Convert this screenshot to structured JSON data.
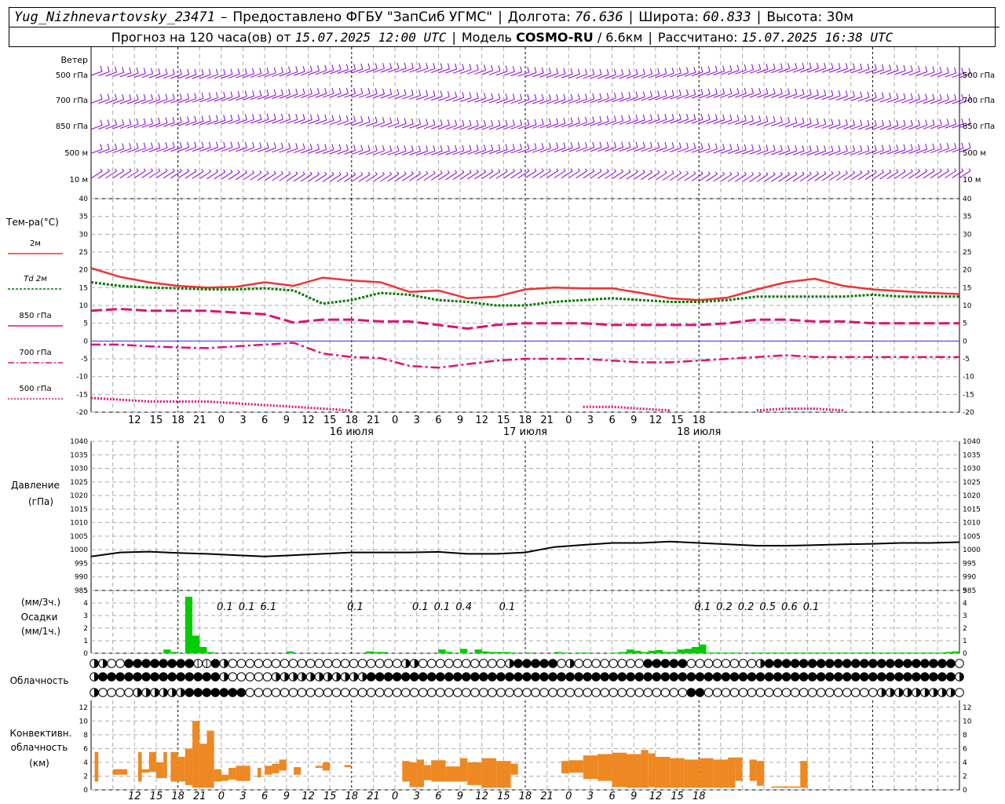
{
  "header": {
    "station": "Yug_Nizhnevartovsky_23471",
    "dash": "–",
    "provider": "Предоставлено ФГБУ \"ЗапСиб УГМС\"",
    "lon_label": "Долгота:",
    "lon_value": "76.636",
    "lat_label": "Широта:",
    "lat_value": "60.833",
    "alt_label": "Высота:",
    "alt_value": "30м",
    "forecast_label": "Прогноз на 120 часа(ов) от",
    "forecast_time": "15.07.2025 12:00 UTC",
    "model_label": "Модель",
    "model_name": "COSMO-RU",
    "model_res": "/ 6.6км",
    "computed_label": "Рассчитано:",
    "computed_time": "15.07.2025 16:38 UTC"
  },
  "panels": {
    "wind": {
      "title": "Ветер",
      "levels": [
        "500 гПа",
        "700 гПа",
        "850 гПа",
        "500 м",
        "10 м"
      ]
    },
    "temp": {
      "title": "Тем-ра(°C)",
      "legend": [
        "2м",
        "Td 2м",
        "850 гПа",
        "700 гПа",
        "500 гПа"
      ]
    },
    "pressure": {
      "title1": "Давление",
      "title2": "(гПа)"
    },
    "precip": {
      "title1": "(мм/3ч.)",
      "title2": "Осадки",
      "title3": "(мм/1ч.)"
    },
    "clouds": {
      "title": "Облачность"
    },
    "conv": {
      "title1": "Конвективн.",
      "title2": "облачность",
      "title3": "(км)"
    }
  },
  "colors": {
    "t2m": "#ee3333",
    "td2m": "#007700",
    "t850": "#dd1177",
    "t700": "#dd1177",
    "t500": "#dd1177",
    "wind": "#8800cc",
    "precip": "#00cc00",
    "conv": "#ee8822",
    "pressure": "#000000",
    "grid": "#aaaaaa",
    "zero": "#3333ff"
  },
  "chart_data": [
    {
      "type": "line",
      "title": "Тем-ра(°C)",
      "x_hours": [
        0,
        3,
        6,
        9,
        12,
        15,
        18,
        21,
        24,
        27,
        30,
        33,
        36,
        39,
        42,
        45,
        48,
        51,
        54,
        57,
        60,
        63,
        66,
        69,
        72,
        75,
        78,
        81,
        84,
        87,
        90,
        93,
        96,
        99,
        102,
        105,
        108,
        111,
        114,
        117,
        120
      ],
      "x_tick_labels": [
        "12",
        "15",
        "18",
        "21",
        "0",
        "3",
        "6",
        "9",
        "12",
        "15",
        "18",
        "21",
        "0",
        "3",
        "6",
        "9",
        "12",
        "15",
        "18",
        "21",
        "0",
        "3",
        "6",
        "9",
        "12",
        "15",
        "18"
      ],
      "date_labels": [
        "16 июля",
        "17 июля",
        "18 июля"
      ],
      "ylim": [
        -20,
        40
      ],
      "yticks": [
        40,
        35,
        30,
        25,
        20,
        15,
        10,
        5,
        0,
        -5,
        -10,
        -15,
        -20
      ],
      "series": [
        {
          "name": "2м",
          "color": "#ee3333",
          "style": "solid",
          "values": [
            20.5,
            18,
            16.5,
            15.5,
            15,
            15.2,
            16.5,
            15.5,
            17.8,
            17,
            16.5,
            13.8,
            14.2,
            12,
            12.5,
            14.5,
            15,
            14.8,
            14.8,
            13.5,
            12,
            11.5,
            12.2,
            14.5,
            16.5,
            17.5,
            15.5,
            14.5,
            14,
            13.5,
            13.2
          ]
        },
        {
          "name": "Td 2м",
          "color": "#007700",
          "style": "dotted",
          "values": [
            16.5,
            15.5,
            15,
            14.8,
            14.5,
            14.5,
            14.8,
            14.2,
            10.5,
            11.5,
            13.5,
            13,
            11.5,
            11,
            10,
            10,
            11,
            11.5,
            12,
            11.5,
            11,
            11,
            11.5,
            12.5,
            12.5,
            12.5,
            12.5,
            13,
            12.5,
            12.5,
            12.5
          ]
        },
        {
          "name": "850 гПа",
          "color": "#dd1177",
          "style": "dashed",
          "values": [
            8.5,
            9,
            8.5,
            8.5,
            8.5,
            8,
            7.5,
            5.2,
            6,
            6,
            5.5,
            5.5,
            4.5,
            3.5,
            4.5,
            5,
            5,
            5,
            4.5,
            4.5,
            4.5,
            4.5,
            5,
            6,
            6,
            5.5,
            5.5,
            5,
            5,
            5,
            5
          ]
        },
        {
          "name": "700 гПа",
          "color": "#dd1177",
          "style": "dashdot",
          "values": [
            -1,
            -1,
            -1.5,
            -1.8,
            -2,
            -1.5,
            -1,
            -0.5,
            -3.5,
            -4.5,
            -4.8,
            -7,
            -7.5,
            -6.5,
            -5.5,
            -5,
            -5,
            -5,
            -5.5,
            -6,
            -6,
            -5.5,
            -5,
            -4.5,
            -4,
            -4.5,
            -4.5,
            -4.5,
            -4.5,
            -4.5,
            -4.5
          ]
        },
        {
          "name": "500 гПа",
          "color": "#dd1177",
          "style": "dense-dotted",
          "values": [
            -16,
            -16.5,
            -17,
            -17,
            -17,
            -17.5,
            -18,
            -18.5,
            -19,
            -19.5,
            null,
            null,
            null,
            null,
            null,
            null,
            null,
            -18.5,
            -18.5,
            -19,
            -19.5,
            null,
            null,
            -19.5,
            -19,
            -19,
            -19.5,
            null,
            null,
            null,
            null
          ]
        }
      ]
    },
    {
      "type": "line",
      "title": "Давление (гПа)",
      "ylim": [
        985,
        1040
      ],
      "yticks": [
        1040,
        1035,
        1030,
        1025,
        1020,
        1015,
        1010,
        1005,
        1000,
        995,
        990,
        985
      ],
      "series": [
        {
          "name": "Давление",
          "color": "#000000",
          "values": [
            997.5,
            999,
            999.3,
            998.8,
            998.5,
            998,
            997.5,
            998,
            998.5,
            999,
            999,
            999,
            999.2,
            998.5,
            998.5,
            999,
            1001,
            1001.8,
            1002.5,
            1002.5,
            1003,
            1002.5,
            1002,
            1001.5,
            1001.5,
            1001.7,
            1002,
            1002.2,
            1002.5,
            1002.5,
            1002.8
          ]
        }
      ]
    },
    {
      "type": "bar",
      "title": "Осадки",
      "ylim": [
        0,
        5
      ],
      "yticks": [
        5,
        4,
        3,
        2,
        1,
        0
      ],
      "labels": [
        {
          "hour": 18.5,
          "text": "0.1"
        },
        {
          "hour": 21.5,
          "text": "0.1"
        },
        {
          "hour": 24.5,
          "text": "6.1"
        },
        {
          "hour": 36.5,
          "text": "0.1"
        },
        {
          "hour": 45.5,
          "text": "0.1"
        },
        {
          "hour": 48.5,
          "text": "0.1"
        },
        {
          "hour": 51.5,
          "text": "0.4"
        },
        {
          "hour": 57.5,
          "text": "0.1"
        },
        {
          "hour": 84.5,
          "text": "0.1"
        },
        {
          "hour": 87.5,
          "text": "0.2"
        },
        {
          "hour": 90.5,
          "text": "0.2"
        },
        {
          "hour": 93.5,
          "text": "0.5"
        },
        {
          "hour": 96.5,
          "text": "0.6"
        },
        {
          "hour": 99.5,
          "text": "0.1"
        }
      ],
      "bars_hours": [
        10,
        11,
        13,
        14,
        15,
        16,
        27,
        38,
        39,
        40,
        48,
        49,
        51,
        53,
        54,
        55,
        56,
        57,
        58,
        60,
        64,
        65,
        67,
        68,
        72,
        73,
        74,
        75,
        76,
        77,
        78,
        79,
        80,
        81,
        82,
        83,
        84,
        85,
        86,
        87,
        88,
        89,
        91,
        92,
        93,
        94,
        95,
        96,
        97,
        98,
        99,
        100,
        101,
        102,
        103,
        104,
        105,
        106,
        107,
        108,
        109,
        110,
        111,
        112,
        113,
        114,
        115,
        116,
        117,
        118,
        119
      ],
      "bars_values": [
        0.3,
        0.1,
        4.5,
        1.4,
        0.5,
        0.1,
        0.15,
        0.15,
        0.1,
        0.1,
        0.3,
        0.1,
        0.35,
        0.3,
        0.15,
        0.1,
        0.1,
        0.1,
        0.05,
        0.05,
        0.1,
        0.05,
        0.05,
        0.05,
        0.05,
        0.1,
        0.3,
        0.2,
        0.1,
        0.2,
        0.25,
        0.1,
        0.1,
        0.3,
        0.35,
        0.5,
        0.7,
        0.05,
        0.05,
        0.05,
        0.05,
        0.05,
        0.05,
        0.05,
        0.05,
        0.05,
        0.05,
        0.05,
        0.05,
        0.05,
        0.05,
        0.05,
        0.05,
        0.05,
        0.05,
        0.05,
        0.05,
        0.05,
        0.05,
        0.05,
        0.05,
        0.05,
        0.05,
        0.05,
        0.05,
        0.05,
        0.05,
        0.05,
        0.05,
        0.1,
        0.15
      ]
    },
    {
      "type": "bar",
      "title": "Конвективн. облачность (км)",
      "ylim": [
        0,
        13
      ],
      "yticks": [
        12,
        10,
        8,
        6,
        4,
        2,
        0
      ],
      "ranges": [
        [
          0.5,
          1,
          1.2,
          5.5
        ],
        [
          3,
          5,
          2.2,
          3
        ],
        [
          6.5,
          7,
          1.2,
          5.5
        ],
        [
          7,
          8,
          2.5,
          3
        ],
        [
          8,
          9,
          2.6,
          5.5
        ],
        [
          9,
          10,
          1.7,
          4
        ],
        [
          10,
          10.5,
          1.7,
          5.5
        ],
        [
          11,
          12,
          1.2,
          5.5
        ],
        [
          12,
          13,
          1.2,
          4.8
        ],
        [
          13,
          14,
          0.7,
          6.0
        ],
        [
          14,
          15,
          0.3,
          10
        ],
        [
          15,
          16,
          0.3,
          6.7
        ],
        [
          16,
          17,
          0.3,
          8.6
        ],
        [
          17,
          18,
          1.2,
          3
        ],
        [
          18,
          19,
          1.3,
          2.2
        ],
        [
          19,
          20,
          1.5,
          3.2
        ],
        [
          20,
          22,
          1.3,
          3.5
        ],
        [
          23,
          23.5,
          1.8,
          3.2
        ],
        [
          24,
          25,
          2.2,
          3.5
        ],
        [
          25,
          26,
          2.4,
          3.8
        ],
        [
          26,
          27,
          2.8,
          4.4
        ],
        [
          28,
          29,
          2.2,
          3.3
        ],
        [
          31,
          32,
          3.2,
          3.5
        ],
        [
          32,
          33,
          2.8,
          4.0
        ],
        [
          35,
          36,
          3.3,
          3.6
        ],
        [
          43,
          44,
          1.2,
          4.2
        ],
        [
          44,
          45,
          0.4,
          4
        ],
        [
          45,
          46,
          0.4,
          4.4
        ],
        [
          46,
          47,
          1.4,
          3.6
        ],
        [
          47,
          49,
          1.2,
          4.3
        ],
        [
          49,
          51,
          1.2,
          3.4
        ],
        [
          51,
          52,
          1.2,
          4.6
        ],
        [
          52,
          54,
          0.7,
          4
        ],
        [
          54,
          56,
          0.3,
          4.6
        ],
        [
          56,
          58,
          0.3,
          4.2
        ],
        [
          58,
          59,
          2.2,
          3.8
        ],
        [
          65,
          66,
          2.4,
          4.2
        ],
        [
          66,
          68,
          2.5,
          4.3
        ],
        [
          68,
          70,
          1.6,
          5
        ],
        [
          70,
          72,
          1.3,
          5.2
        ],
        [
          72,
          74,
          0.4,
          5.4
        ],
        [
          74,
          76,
          0.3,
          5.2
        ],
        [
          76,
          77,
          0.3,
          5.8
        ],
        [
          77,
          78,
          0.4,
          5.3
        ],
        [
          78,
          80,
          0.3,
          4.8
        ],
        [
          80,
          82,
          0.3,
          4.6
        ],
        [
          82,
          84,
          0.3,
          4.4
        ],
        [
          84,
          86,
          0.3,
          4.6
        ],
        [
          86,
          88,
          0.3,
          4.4
        ],
        [
          88,
          89,
          0.3,
          4.7
        ],
        [
          89,
          90,
          1.3,
          4.7
        ],
        [
          91,
          92,
          1.3,
          4.4
        ],
        [
          92,
          93,
          0.6,
          4.2
        ],
        [
          94,
          95,
          0.3,
          0.5
        ],
        [
          95,
          97,
          0.3,
          0.5
        ],
        [
          97,
          98,
          0.3,
          0.5
        ],
        [
          98,
          99,
          0.3,
          4.2
        ]
      ]
    }
  ]
}
